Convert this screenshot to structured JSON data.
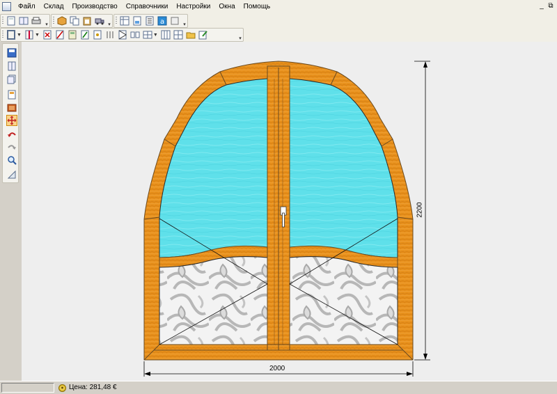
{
  "menu": {
    "items": [
      "Файл",
      "Склад",
      "Производство",
      "Справочники",
      "Настройки",
      "Окна",
      "Помощь"
    ]
  },
  "window_controls": {
    "minimize": "_",
    "restore": "⧉"
  },
  "toolbar_top": {
    "group1_icons": [
      "new-file-icon",
      "grid-icon",
      "print-icon"
    ],
    "group2_icons": [
      "box-icon",
      "copy-icon",
      "paste-icon",
      "truck-icon"
    ],
    "group3_icons": [
      "table-icon",
      "doc-icon",
      "list-icon",
      "text-a-icon",
      "export-icon"
    ]
  },
  "toolbar_second": {
    "icons": [
      "frame-icon",
      "mullion-icon",
      "delete-icon",
      "cut-icon",
      "calc-icon",
      "profile-icon",
      "hardware-icon",
      "align-icon",
      "sash-icon",
      "merge-icon",
      "split-icon",
      "grid-icon",
      "grid2-icon",
      "folder-icon",
      "edit-icon"
    ]
  },
  "left_toolbar": {
    "icons": [
      "save-icon",
      "frame-view-icon",
      "layers-icon",
      "report-icon",
      "color-icon",
      "move-icon",
      "undo-icon",
      "redo-icon",
      "zoom-icon",
      "measure-icon"
    ]
  },
  "drawing": {
    "width_label": "2000",
    "height_label": "2200",
    "frame_color": "#e8911c",
    "glass_color": "#5fe0ea"
  },
  "status": {
    "price_label": "Цена: 281,48 €"
  }
}
